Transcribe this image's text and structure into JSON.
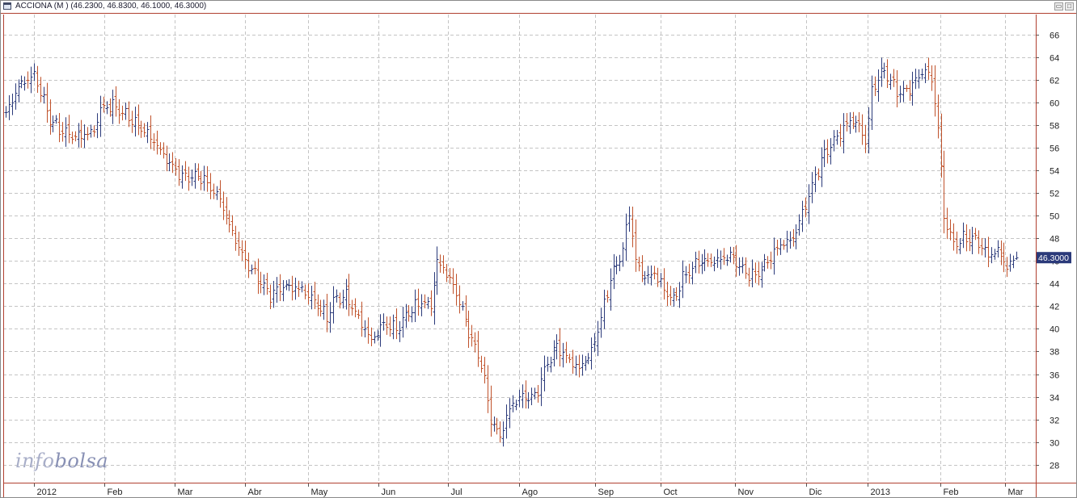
{
  "window": {
    "title": "ACCIONA (M ) (46.2300, 46.8300, 46.1000, 46.3000)"
  },
  "watermark": {
    "part1": "info",
    "part2": "bolsa"
  },
  "colors": {
    "up": "#2b3a7a",
    "down": "#c0522b",
    "grid": "#c4c4c4",
    "axis": "#b04030",
    "tag_bg": "#2b3a7a"
  },
  "chart_data": {
    "type": "ohlc",
    "title": "ACCIONA (M )",
    "last": {
      "open": 46.23,
      "high": 46.83,
      "low": 46.1,
      "close": 46.3,
      "label": "46.3000"
    },
    "ylim": [
      26.4,
      67.8
    ],
    "y_ticks": [
      28,
      30,
      32,
      34,
      36,
      38,
      40,
      42,
      44,
      46,
      48,
      50,
      52,
      54,
      56,
      58,
      60,
      62,
      64,
      66
    ],
    "y_tick_labels": [
      "28",
      "30",
      "32",
      "34",
      "36",
      "38",
      "40",
      "42",
      "44",
      "46",
      "48",
      "50",
      "52",
      "54",
      "56",
      "58",
      "60",
      "62",
      "64",
      "66"
    ],
    "x_labels": [
      "2012",
      "Feb",
      "Mar",
      "Abr",
      "May",
      "Jun",
      "Jul",
      "Ago",
      "Sep",
      "Oct",
      "Nov",
      "Dic",
      "2013",
      "Feb",
      "Mar"
    ],
    "grid": true,
    "anchors": [
      [
        0,
        59
      ],
      [
        4,
        61.5
      ],
      [
        9,
        62.5
      ],
      [
        11,
        61
      ],
      [
        14,
        58.5
      ],
      [
        18,
        57.5
      ],
      [
        22,
        57
      ],
      [
        28,
        57.5
      ],
      [
        30,
        59.5
      ],
      [
        34,
        59.8
      ],
      [
        40,
        58.5
      ],
      [
        46,
        57
      ],
      [
        51,
        55
      ],
      [
        56,
        53.5
      ],
      [
        62,
        53.5
      ],
      [
        68,
        51.5
      ],
      [
        72,
        48.5
      ],
      [
        76,
        46
      ],
      [
        80,
        44.5
      ],
      [
        84,
        43
      ],
      [
        88,
        43.8
      ],
      [
        94,
        43.5
      ],
      [
        98,
        42.5
      ],
      [
        102,
        41
      ],
      [
        104,
        42.5
      ],
      [
        108,
        43
      ],
      [
        112,
        41
      ],
      [
        116,
        39
      ],
      [
        120,
        40.5
      ],
      [
        124,
        40
      ],
      [
        128,
        41.5
      ],
      [
        132,
        42.5
      ],
      [
        135,
        42
      ],
      [
        137,
        46
      ],
      [
        140,
        45
      ],
      [
        144,
        42.5
      ],
      [
        148,
        39
      ],
      [
        151,
        37
      ],
      [
        154,
        32
      ],
      [
        157,
        30.5
      ],
      [
        160,
        33
      ],
      [
        163,
        34
      ],
      [
        168,
        34
      ],
      [
        172,
        37
      ],
      [
        175,
        38.5
      ],
      [
        178,
        37.5
      ],
      [
        182,
        36.5
      ],
      [
        186,
        38
      ],
      [
        189,
        41
      ],
      [
        192,
        44.5
      ],
      [
        196,
        47
      ],
      [
        198,
        50.5
      ],
      [
        200,
        46
      ],
      [
        203,
        44.5
      ],
      [
        206,
        45
      ],
      [
        209,
        43.5
      ],
      [
        212,
        42.5
      ],
      [
        215,
        44.5
      ],
      [
        220,
        46
      ],
      [
        225,
        46
      ],
      [
        230,
        46.5
      ],
      [
        235,
        45
      ],
      [
        238,
        44.7
      ],
      [
        242,
        46
      ],
      [
        246,
        47.5
      ],
      [
        250,
        48
      ],
      [
        254,
        51
      ],
      [
        257,
        53.5
      ],
      [
        260,
        55.5
      ],
      [
        264,
        57
      ],
      [
        268,
        58.5
      ],
      [
        271,
        58
      ],
      [
        273,
        56.5
      ],
      [
        275,
        61
      ],
      [
        278,
        62.8
      ],
      [
        280,
        62.5
      ],
      [
        283,
        61
      ],
      [
        286,
        61
      ],
      [
        289,
        62
      ],
      [
        292,
        63
      ],
      [
        294,
        62
      ],
      [
        296,
        58
      ],
      [
        298,
        50
      ],
      [
        301,
        47.5
      ],
      [
        304,
        48
      ],
      [
        308,
        48
      ],
      [
        312,
        46.5
      ],
      [
        315,
        47
      ],
      [
        318,
        45.5
      ],
      [
        320,
        46
      ],
      [
        321,
        46.3
      ]
    ]
  }
}
